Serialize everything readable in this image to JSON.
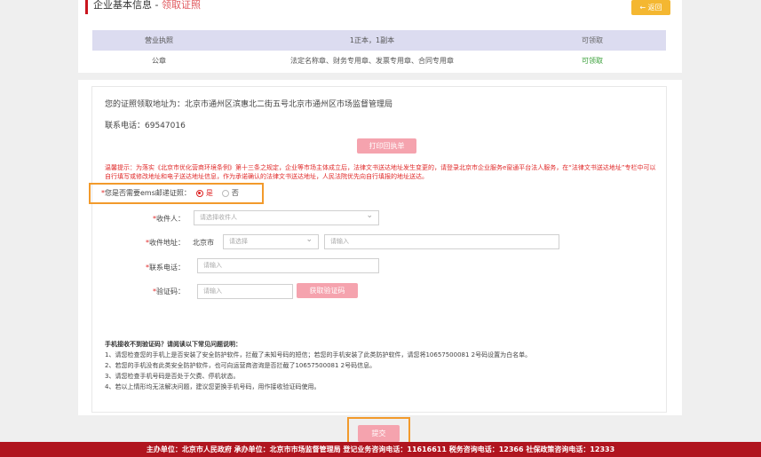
{
  "header": {
    "title": "企业基本信息",
    "separator": " - ",
    "subtitle": "领取证照",
    "back_label": "← 返回"
  },
  "licenses": [
    {
      "name": "营业执照",
      "detail": "1正本，1副本",
      "status": "可领取",
      "status_color": "#666666"
    },
    {
      "name": "公章",
      "detail": "法定名称章、财务专用章、发票专用章、合同专用章",
      "status": "可领取",
      "status_color": "#3aa03a"
    }
  ],
  "pickup": {
    "address": "您的证照领取地址为：北京市通州区滨惠北二街五号北京市通州区市场监督管理局",
    "phone": "联系电话：69547016",
    "print_label": "打印回执单"
  },
  "tip": "温馨提示：为落实《北京市优化营商环境条例》第十三条之规定，企业等市场主体成立后，法律文书送达地址发生变更的，请登录北京市企业服务e窗通平台法人服务，在“法律文书送达地址”专栏中可以自行填写或修改地址和电子送达地址信息，作为承诺确认的法律文书送达地址，人民法院优先向自行填报的地址送达。",
  "ems": {
    "question": "您是否需要ems邮递证照：",
    "yes": "是",
    "no": "否",
    "selected": "是"
  },
  "form": {
    "recipient_label": "收件人：",
    "recipient_placeholder": "请选择收件人",
    "address_label": "收件地址：",
    "city": "北京市",
    "district_placeholder": "请选择",
    "detail_placeholder": "请输入",
    "phone_label": "联系电话：",
    "phone_placeholder": "请输入",
    "code_label": "验证码：",
    "code_placeholder": "请输入",
    "get_code_label": "获取验证码"
  },
  "faq": {
    "title": "手机接收不到验证码？请阅读以下常见问题说明：",
    "items": [
      "1、请您检查您的手机上是否安装了安全防护软件，拦截了未知号码的短信；若您的手机安装了此类防护软件，请您将10657500081 2号码设置为白名单。",
      "2、若您的手机没有此类安全防护软件，也可向运营商咨询是否拦截了10657500081 2号码信息。",
      "3、请您检查手机号码是否处于欠费、停机状态。",
      "4、若以上情形均无法解决问题，建议您更换手机号码，用作接收验证码使用。"
    ]
  },
  "submit_label": "提交",
  "footer": "主办单位：北京市人民政府  承办单位：北京市市场监督管理局  登记业务咨询电话：11616611  税务咨询电话：12366  社保政策咨询电话：12333",
  "colors": {
    "brand_red": "#b0151f",
    "button_pink": "#f5a3ae",
    "highlight_orange": "#f29a2b",
    "back_yellow": "#f4b731"
  }
}
